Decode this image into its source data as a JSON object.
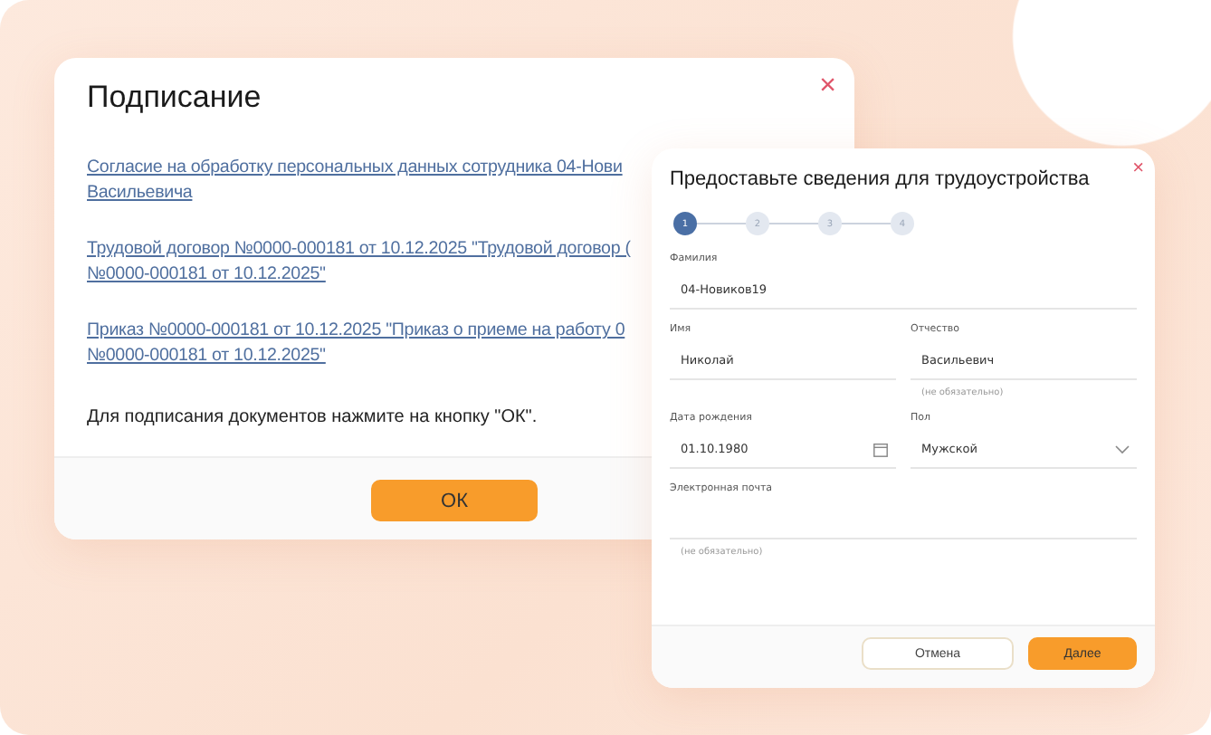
{
  "signing_dialog": {
    "title": "Подписание",
    "close": "×",
    "documents": [
      {
        "lines": [
          "Согласие на обработку персональных данных сотрудника 04-Нови",
          "Васильевича"
        ]
      },
      {
        "lines": [
          "Трудовой договор №0000-000181 от 10.12.2025 \"Трудовой договор (",
          "№0000-000181 от 10.12.2025\""
        ]
      },
      {
        "lines": [
          "Приказ №0000-000181 от 10.12.2025 \"Приказ о приеме на работу 0",
          "№0000-000181 от 10.12.2025\""
        ]
      }
    ],
    "instruction": "Для подписания документов нажмите на кнопку \"ОК\".",
    "ok_button": "ОК"
  },
  "employment_dialog": {
    "title": "Предоставьте сведения для трудоустройства",
    "close": "×",
    "steps": [
      {
        "label": "1",
        "selected": true
      },
      {
        "label": "2",
        "selected": false
      },
      {
        "label": "3",
        "selected": false
      },
      {
        "label": "4",
        "selected": false
      }
    ],
    "rows": [
      [
        {
          "kind": "text",
          "label": "Фамилия",
          "value": "04-Новиков19"
        }
      ],
      [
        {
          "kind": "text",
          "label": "Имя",
          "value": "Николай"
        },
        {
          "kind": "text",
          "label": "Отчество",
          "value": "Васильевич",
          "hint": "(не обязательно)"
        }
      ],
      [
        {
          "kind": "date",
          "label": "Дата рождения",
          "value": "01.10.1980"
        },
        {
          "kind": "select",
          "label": "Пол",
          "value": "Мужской"
        }
      ],
      [
        {
          "kind": "text",
          "label": "Электронная почта",
          "hint": "(не обязательно)"
        }
      ]
    ],
    "cancel_button": "Отмена",
    "next_button": "Далее"
  }
}
